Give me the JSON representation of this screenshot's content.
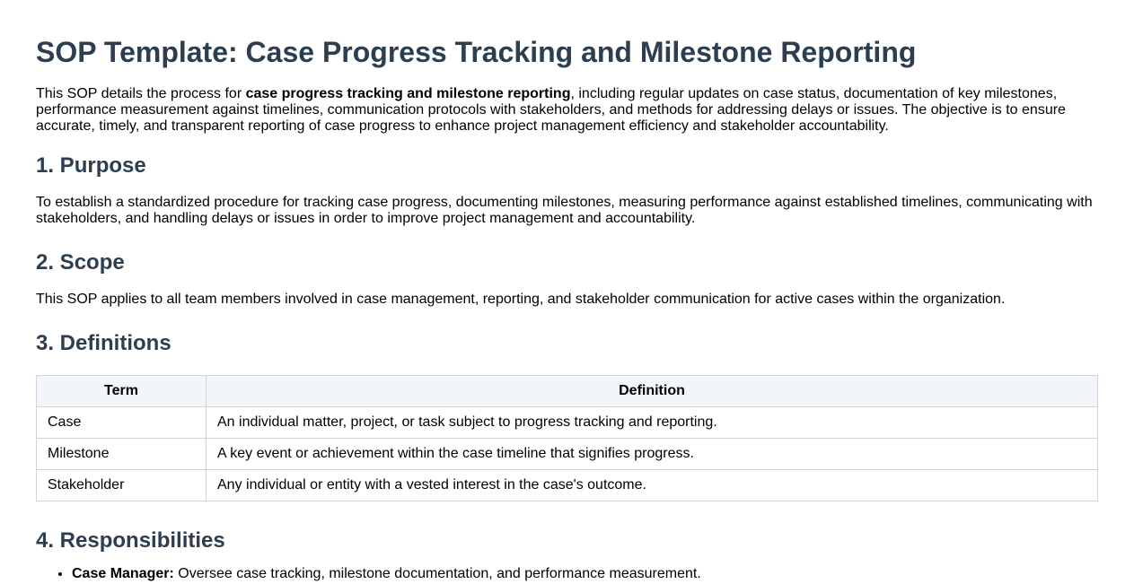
{
  "title": "SOP Template: Case Progress Tracking and Milestone Reporting",
  "intro": {
    "before": "This SOP details the process for ",
    "bold": "case progress tracking and milestone reporting",
    "after": ", including regular updates on case status, documentation of key milestones, performance measurement against timelines, communication protocols with stakeholders, and methods for addressing delays or issues. The objective is to ensure accurate, timely, and transparent reporting of case progress to enhance project management efficiency and stakeholder accountability."
  },
  "purpose": {
    "heading": "1. Purpose",
    "text": "To establish a standardized procedure for tracking case progress, documenting milestones, measuring performance against established timelines, communicating with stakeholders, and handling delays or issues in order to improve project management and accountability."
  },
  "scope": {
    "heading": "2. Scope",
    "text": "This SOP applies to all team members involved in case management, reporting, and stakeholder communication for active cases within the organization."
  },
  "definitions": {
    "heading": "3. Definitions",
    "columns": [
      "Term",
      "Definition"
    ],
    "rows": [
      {
        "term": "Case",
        "definition": "An individual matter, project, or task subject to progress tracking and reporting."
      },
      {
        "term": "Milestone",
        "definition": "A key event or achievement within the case timeline that signifies progress."
      },
      {
        "term": "Stakeholder",
        "definition": "Any individual or entity with a vested interest in the case's outcome."
      }
    ]
  },
  "responsibilities": {
    "heading": "4. Responsibilities",
    "items": [
      {
        "role": "Case Manager:",
        "text": " Oversee case tracking, milestone documentation, and performance measurement."
      }
    ]
  },
  "colors": {
    "heading": "#2c3e50",
    "table_header_bg": "#f2f5fa",
    "table_border": "#d0d5dc"
  }
}
